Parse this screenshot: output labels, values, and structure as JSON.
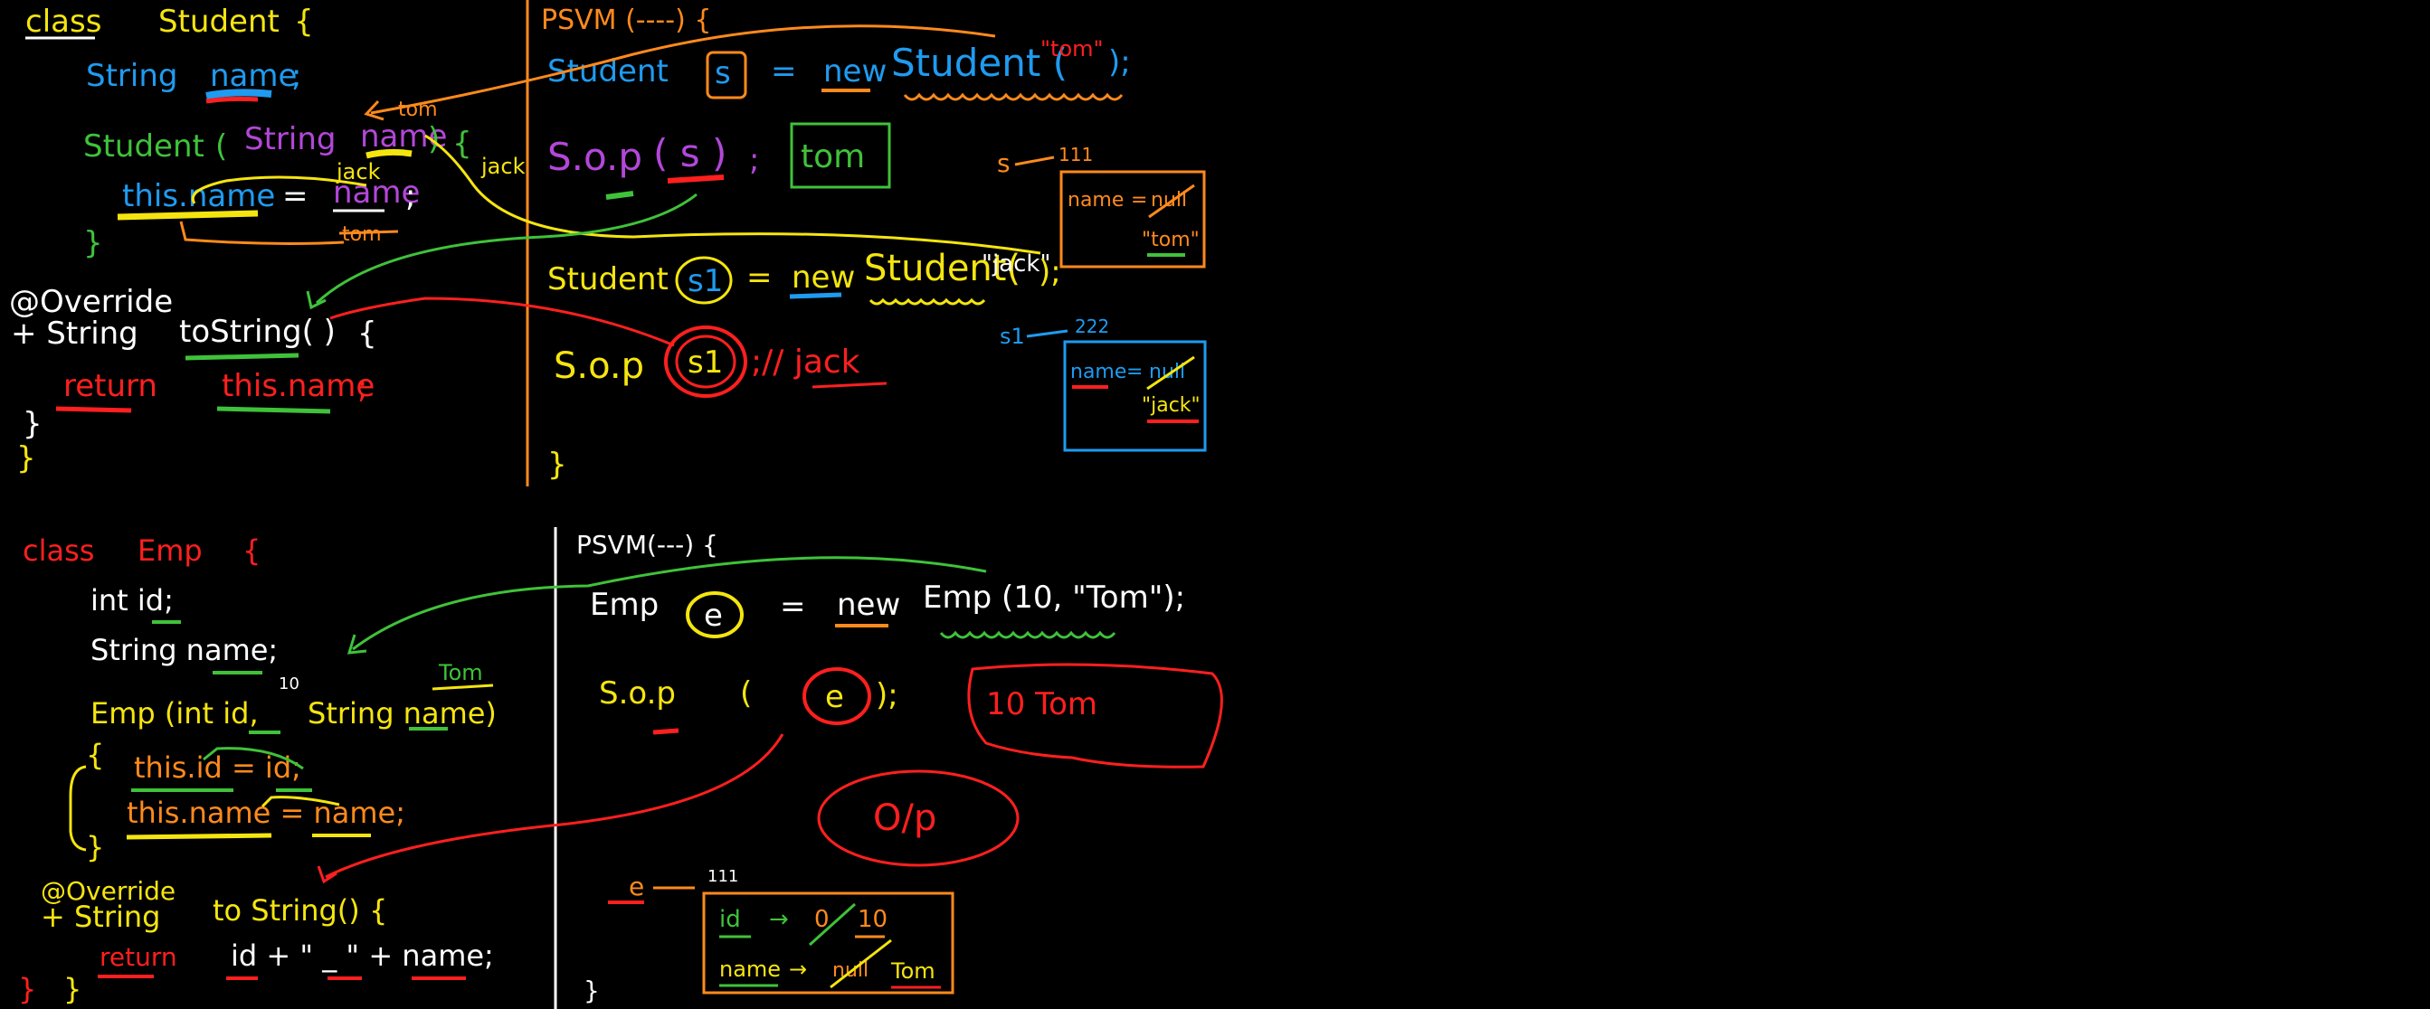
{
  "colors": {
    "yellow": "#f5e50f",
    "blue": "#1f9bf0",
    "green": "#3fc23a",
    "purple": "#b347d9",
    "orange": "#ff8a1c",
    "red": "#ff1f1f",
    "white": "#ffffff",
    "background": "#000000"
  },
  "student_class": {
    "line1_kw": "class",
    "line1_name": "Student",
    "line1_brace": "{",
    "field_type": "String",
    "field_name": "name",
    "field_semi": ";",
    "ctor_name": "Student",
    "ctor_open": "(",
    "ctor_param_type": "String",
    "ctor_param_name": "name",
    "ctor_close": ")",
    "ctor_brace": "{",
    "note_tom": "tom",
    "note_jack": "jack",
    "note_jack2": "jack",
    "assign_lhs": "this.name",
    "assign_eq": "=",
    "assign_rhs": "name",
    "assign_semi": ";",
    "note_tom_struck": "tom",
    "ctor_end": "}",
    "annotation": "@Override",
    "tostring_sig_a": "+ String",
    "tostring_sig_b": "toString( )",
    "tostring_brace": "{",
    "return_kw": "return",
    "return_expr": "this.name",
    "return_semi": ";",
    "method_end": "}",
    "class_end": "}"
  },
  "student_main": {
    "psvm": "PSVM (----) {",
    "l1_type": "Student",
    "l1_var": "s",
    "l1_eq": "=",
    "l1_new": "new",
    "l1_ctor": "Student (",
    "l1_arg": "\"tom\"",
    "l1_end": ");",
    "l2_call": "S.o.p",
    "l2_arg": "( s )",
    "l2_semi": ";",
    "l2_out": "tom",
    "l3_type": "Student",
    "l3_var": "s1",
    "l3_eq": "=",
    "l3_new": "new",
    "l3_ctor": "Student(",
    "l3_arg": "\"jack\"",
    "l3_end": ");",
    "l4_call": "S.o.p",
    "l4_arg": "s1",
    "l4_out": ";// jack",
    "main_end": "}",
    "mem1_ref": "s",
    "mem1_addr": "111",
    "mem1_field": "name",
    "mem1_eq": "=",
    "mem1_old": "null",
    "mem1_new": "\"tom\"",
    "mem2_ref": "s1",
    "mem2_addr": "222",
    "mem2_field": "name",
    "mem2_eq": "=",
    "mem2_old": "null",
    "mem2_new": "\"jack\""
  },
  "emp_class": {
    "line1_kw": "class",
    "line1_name": "Emp",
    "line1_brace": "{",
    "field1": "int id;",
    "field2": "String name;",
    "ctor_sig_a": "Emp (int id,",
    "ctor_sig_b": "String name)",
    "note_10": "10",
    "note_tom": "Tom",
    "ctor_open": "{",
    "assign1": "this.id = id;",
    "assign2": "this.name = name;",
    "ctor_close": "}",
    "annotation": "@Override",
    "tostring_sig_a": "+ String",
    "tostring_sig_b": "to String() {",
    "return_kw": "return",
    "return_expr": "id + \" _ \" + name;",
    "end_red": "}",
    "class_end": "}"
  },
  "emp_main": {
    "psvm": "PSVM(---) {",
    "l1_type": "Emp",
    "l1_var": "e",
    "l1_eq": "=",
    "l1_new": "new",
    "l1_ctor": "Emp (10, \"Tom\");",
    "l2_call": "S.o.p",
    "l2_open": "(",
    "l2_var": "e",
    "l2_close": ");",
    "l2_out": "10 Tom",
    "op_label": "O/p",
    "mem_ref": "e",
    "mem_addr": "111",
    "mem_f1": "id",
    "mem_arrow1": "→",
    "mem_old1": "0",
    "mem_new1": "10",
    "mem_f2": "name",
    "mem_arrow2": "→",
    "mem_old2": "null",
    "mem_new2": "Tom",
    "main_end": "}"
  }
}
